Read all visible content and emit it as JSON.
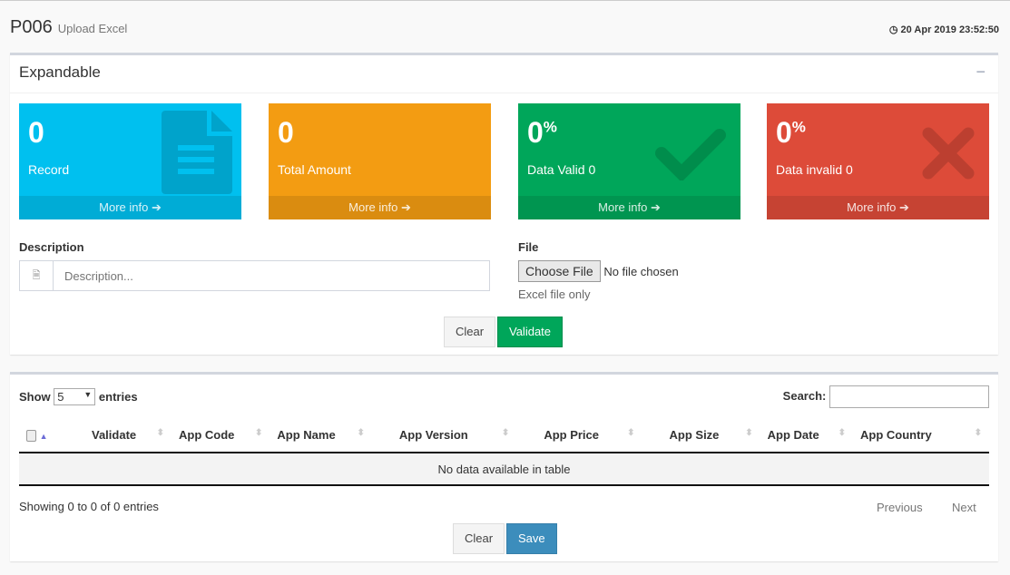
{
  "header": {
    "title": "P006",
    "subtitle": "Upload Excel",
    "datetime": "20 Apr 2019 23:52:50"
  },
  "panel": {
    "title": "Expandable",
    "collapse": "−"
  },
  "tiles": [
    {
      "value": "0",
      "suffix": "",
      "label": "Record",
      "more": "More info ➔",
      "color": "#00c0ef",
      "icon": "file-text-icon"
    },
    {
      "value": "0",
      "suffix": "",
      "label": "Total Amount",
      "more": "More info ➔",
      "color": "#f39c12",
      "icon": ""
    },
    {
      "value": "0",
      "suffix": "%",
      "label": "Data Valid 0",
      "more": "More info ➔",
      "color": "#00a65a",
      "icon": "check-icon"
    },
    {
      "value": "0",
      "suffix": "%",
      "label": "Data invalid 0",
      "more": "More info ➔",
      "color": "#dd4b39",
      "icon": "times-icon"
    }
  ],
  "form": {
    "description_label": "Description",
    "description_placeholder": "Description...",
    "file_label": "File",
    "choose_file": "Choose File",
    "no_file": "No file chosen",
    "file_help": "Excel file only",
    "clear": "Clear",
    "validate": "Validate"
  },
  "table": {
    "show": "Show",
    "entries_value": "5",
    "entries": "entries",
    "search_label": "Search:",
    "columns": [
      "Validate",
      "App Code",
      "App Name",
      "App Version",
      "App Price",
      "App Size",
      "App Date",
      "App Country"
    ],
    "empty": "No data available in table",
    "info": "Showing 0 to 0 of 0 entries",
    "previous": "Previous",
    "next": "Next",
    "clear": "Clear",
    "save": "Save"
  }
}
